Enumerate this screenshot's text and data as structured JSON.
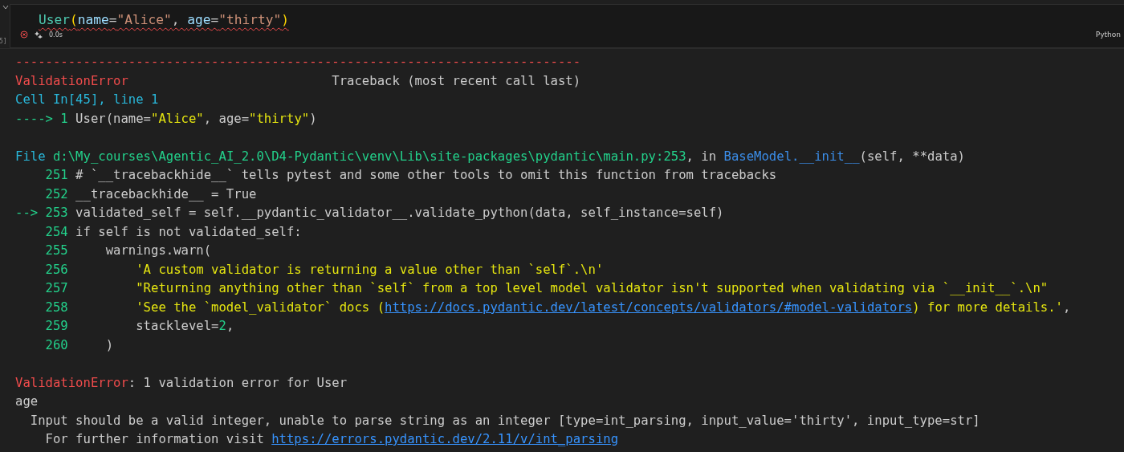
{
  "cell": {
    "execution_count_fragment": "5]",
    "collapsed": false,
    "code": [
      {
        "kind": "class",
        "text": "User"
      },
      {
        "kind": "paren",
        "text": "("
      },
      {
        "kind": "param",
        "text": "name"
      },
      {
        "kind": "plain",
        "text": "="
      },
      {
        "kind": "string",
        "text": "\"Alice\""
      },
      {
        "kind": "plain",
        "text": ", "
      },
      {
        "kind": "param",
        "text": "age"
      },
      {
        "kind": "plain",
        "text": "="
      },
      {
        "kind": "string",
        "text": "\"thirty\""
      },
      {
        "kind": "paren",
        "text": ")"
      }
    ],
    "has_error": true,
    "duration": "0.0s",
    "language": "Python"
  },
  "output": [
    {
      "kind": "text",
      "segments": [
        {
          "kind": "error",
          "text": "---------------------------------------------------------------------------"
        }
      ]
    },
    {
      "kind": "text",
      "segments": [
        {
          "kind": "error",
          "text": "ValidationError"
        },
        {
          "kind": "plain",
          "text": "                           Traceback (most recent call last)"
        }
      ]
    },
    {
      "kind": "text",
      "segments": [
        {
          "kind": "header",
          "text": "Cell In[45], line 1"
        }
      ]
    },
    {
      "kind": "text",
      "segments": [
        {
          "kind": "green",
          "text": "----> 1"
        },
        {
          "kind": "plain",
          "text": " User(name="
        },
        {
          "kind": "string",
          "text": "\"Alice\""
        },
        {
          "kind": "plain",
          "text": ", age="
        },
        {
          "kind": "string",
          "text": "\"thirty\""
        },
        {
          "kind": "plain",
          "text": ")"
        }
      ]
    },
    {
      "kind": "blank"
    },
    {
      "kind": "text",
      "segments": [
        {
          "kind": "header",
          "text": "File "
        },
        {
          "kind": "green",
          "text": "d:\\My_courses\\Agentic_AI_2.0\\D4-Pydantic\\venv\\Lib\\site-packages\\pydantic\\main.py:253"
        },
        {
          "kind": "plain",
          "text": ", in "
        },
        {
          "kind": "func",
          "text": "BaseModel.__init__"
        },
        {
          "kind": "plain",
          "text": "(self, **data)"
        }
      ]
    },
    {
      "kind": "text",
      "segments": [
        {
          "kind": "green",
          "text": "    251"
        },
        {
          "kind": "plain",
          "text": " # `__tracebackhide__` tells pytest and some other tools to omit this function from tracebacks"
        }
      ]
    },
    {
      "kind": "text",
      "segments": [
        {
          "kind": "green",
          "text": "    252"
        },
        {
          "kind": "plain",
          "text": " __tracebackhide__ = True"
        }
      ]
    },
    {
      "kind": "text",
      "segments": [
        {
          "kind": "green",
          "text": "--> 253"
        },
        {
          "kind": "plain",
          "text": " validated_self = self.__pydantic_validator__.validate_python(data, self_instance=self)"
        }
      ]
    },
    {
      "kind": "text",
      "segments": [
        {
          "kind": "green",
          "text": "    254"
        },
        {
          "kind": "plain",
          "text": " if self is not validated_self:"
        }
      ]
    },
    {
      "kind": "text",
      "segments": [
        {
          "kind": "green",
          "text": "    255"
        },
        {
          "kind": "plain",
          "text": "     warnings.warn("
        }
      ]
    },
    {
      "kind": "text",
      "segments": [
        {
          "kind": "green",
          "text": "    256"
        },
        {
          "kind": "string",
          "text": "         'A custom validator is returning a value other than `self`.\\n'"
        }
      ]
    },
    {
      "kind": "text",
      "segments": [
        {
          "kind": "green",
          "text": "    257"
        },
        {
          "kind": "string",
          "text": "         \"Returning anything other than `self` from a top level model validator isn't supported when validating via `__init__`.\\n\""
        }
      ]
    },
    {
      "kind": "text",
      "segments": [
        {
          "kind": "green",
          "text": "    258"
        },
        {
          "kind": "string",
          "text": "         'See the `model_validator` docs ("
        },
        {
          "kind": "link",
          "text": "https://docs.pydantic.dev/latest/concepts/validators/#model-validators"
        },
        {
          "kind": "string",
          "text": ") for more details.'"
        },
        {
          "kind": "plain",
          "text": ","
        }
      ]
    },
    {
      "kind": "text",
      "segments": [
        {
          "kind": "green",
          "text": "    259"
        },
        {
          "kind": "plain",
          "text": "         stacklevel="
        },
        {
          "kind": "green",
          "text": "2"
        },
        {
          "kind": "plain",
          "text": ","
        }
      ]
    },
    {
      "kind": "text",
      "segments": [
        {
          "kind": "green",
          "text": "    260"
        },
        {
          "kind": "plain",
          "text": "     )"
        }
      ]
    },
    {
      "kind": "blank"
    },
    {
      "kind": "text",
      "segments": [
        {
          "kind": "error",
          "text": "ValidationError"
        },
        {
          "kind": "plain",
          "text": ": 1 validation error for User"
        }
      ]
    },
    {
      "kind": "text",
      "segments": [
        {
          "kind": "plain",
          "text": "age"
        }
      ]
    },
    {
      "kind": "text",
      "segments": [
        {
          "kind": "plain",
          "text": "  Input should be a valid integer, unable to parse string as an integer [type=int_parsing, input_value='thirty', input_type=str]"
        }
      ]
    },
    {
      "kind": "text",
      "segments": [
        {
          "kind": "plain",
          "text": "    For further information visit "
        },
        {
          "kind": "link",
          "text": "https://errors.pydantic.dev/2.11/v/int_parsing"
        }
      ]
    }
  ]
}
